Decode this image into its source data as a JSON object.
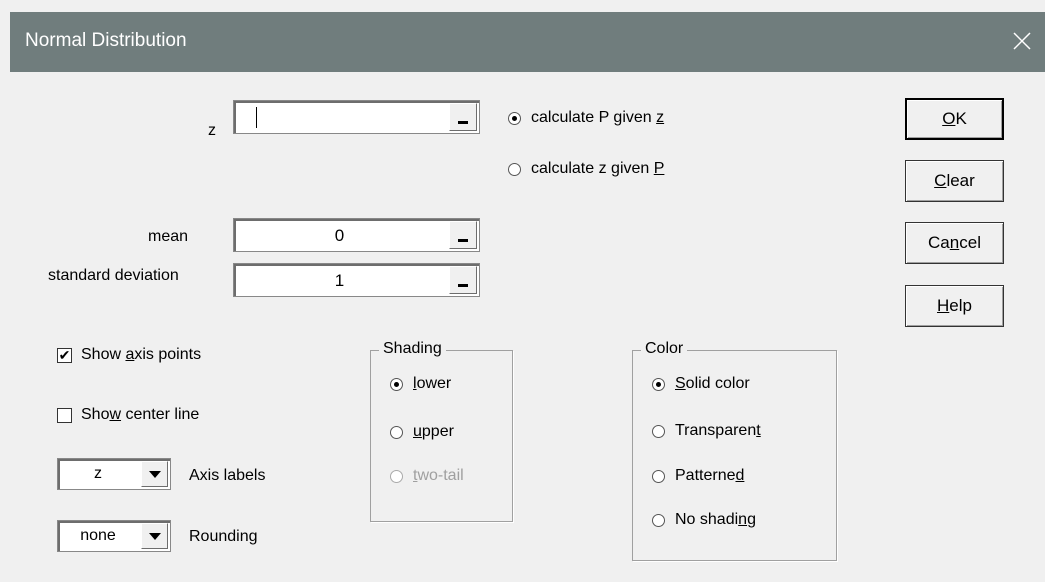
{
  "window": {
    "title": "Normal Distribution"
  },
  "fields": {
    "z": {
      "label": "z",
      "value": ""
    },
    "mean": {
      "label": "mean",
      "value": "0"
    },
    "sd": {
      "label": "standard deviation",
      "value": "1"
    }
  },
  "calc_mode": {
    "options": [
      {
        "pre": "calculate P given ",
        "ul": "z",
        "post": "",
        "selected": true
      },
      {
        "pre": "calculate z given ",
        "ul": "P",
        "post": "",
        "selected": false
      }
    ]
  },
  "buttons": {
    "ok": {
      "pre": "",
      "ul": "O",
      "post": "K"
    },
    "clear": {
      "pre": "",
      "ul": "C",
      "post": "lear"
    },
    "cancel": {
      "pre": "Ca",
      "ul": "n",
      "post": "cel"
    },
    "help": {
      "pre": "",
      "ul": "H",
      "post": "elp"
    }
  },
  "options": {
    "show_axis_points": {
      "pre": "Show ",
      "ul": "a",
      "post": "xis points",
      "checked": true
    },
    "show_center_line": {
      "pre": "Sho",
      "ul": "w",
      "post": " center line",
      "checked": false
    },
    "axis_labels": {
      "value": "z",
      "label": "Axis labels"
    },
    "rounding": {
      "value": "none",
      "label": "Rounding"
    }
  },
  "shading": {
    "title": "Shading",
    "options": [
      {
        "pre": "",
        "ul": "l",
        "post": "ower",
        "selected": true,
        "disabled": false
      },
      {
        "pre": "",
        "ul": "u",
        "post": "pper",
        "selected": false,
        "disabled": false
      },
      {
        "pre": "",
        "ul": "t",
        "post": "wo-tail",
        "selected": false,
        "disabled": true
      }
    ]
  },
  "color": {
    "title": "Color",
    "options": [
      {
        "pre": "",
        "ul": "S",
        "post": "olid color",
        "selected": true
      },
      {
        "pre": "Transparen",
        "ul": "t",
        "post": "",
        "selected": false
      },
      {
        "pre": "Patterne",
        "ul": "d",
        "post": "",
        "selected": false
      },
      {
        "pre": "No shadi",
        "ul": "n",
        "post": "g",
        "selected": false
      }
    ]
  }
}
